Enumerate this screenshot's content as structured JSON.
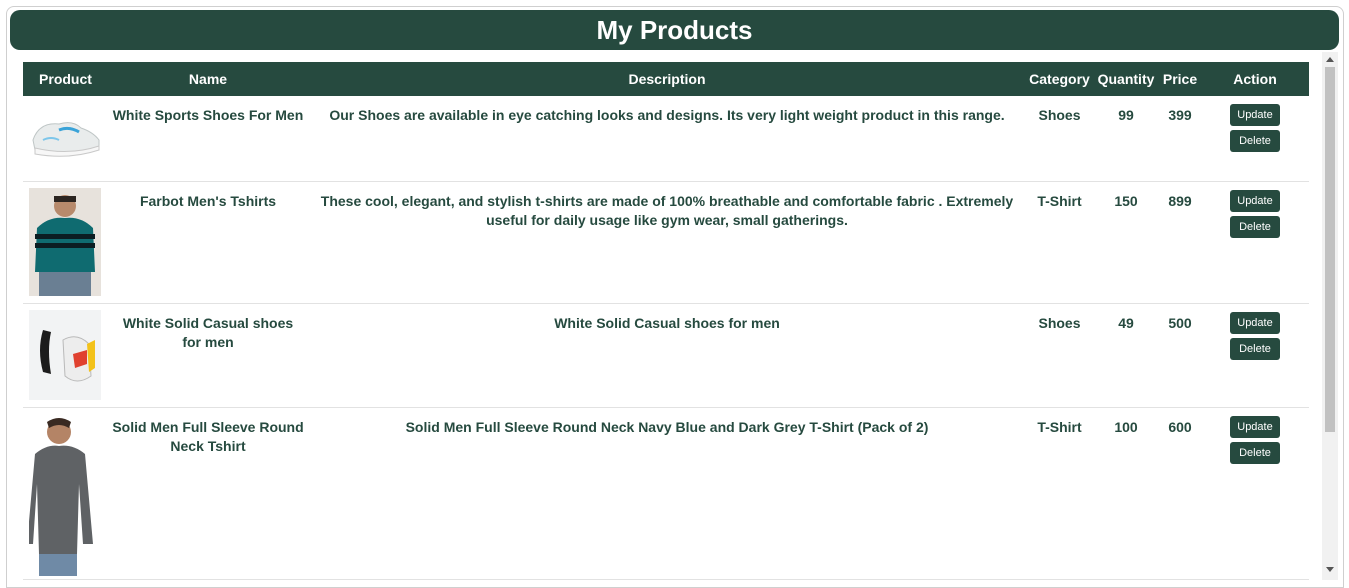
{
  "page": {
    "title": "My Products"
  },
  "table": {
    "headers": {
      "product": "Product",
      "name": "Name",
      "description": "Description",
      "category": "Category",
      "quantity": "Quantity",
      "price": "Price",
      "action": "Action"
    },
    "rows": [
      {
        "image": "shoe-white-sport-image",
        "name": "White Sports Shoes For Men",
        "description": "Our Shoes are available in eye catching looks and designs. Its very light weight product in this range.",
        "category": "Shoes",
        "quantity": "99",
        "price": "399",
        "update_label": "Update",
        "delete_label": "Delete"
      },
      {
        "image": "tshirt-teal-striped-image",
        "name": "Farbot Men's Tshirts",
        "description": "These cool, elegant, and stylish t-shirts are made of 100% breathable and comfortable fabric . Extremely useful for daily usage like gym wear, small gatherings.",
        "category": "T-Shirt",
        "quantity": "150",
        "price": "899",
        "update_label": "Update",
        "delete_label": "Delete"
      },
      {
        "image": "shoe-white-casual-image",
        "name": "White Solid Casual shoes for men",
        "description": "White Solid Casual shoes for men",
        "category": "Shoes",
        "quantity": "49",
        "price": "500",
        "update_label": "Update",
        "delete_label": "Delete"
      },
      {
        "image": "tshirt-grey-fullsleeve-image",
        "name": "Solid Men Full Sleeve Round Neck Tshirt",
        "description": "Solid Men Full Sleeve Round Neck Navy Blue and Dark Grey T-Shirt (Pack of 2)",
        "category": "T-Shirt",
        "quantity": "100",
        "price": "600",
        "update_label": "Update",
        "delete_label": "Delete"
      }
    ]
  },
  "colors": {
    "primary": "#264a3f",
    "text": "#264a3f",
    "header_text": "#ffffff"
  }
}
